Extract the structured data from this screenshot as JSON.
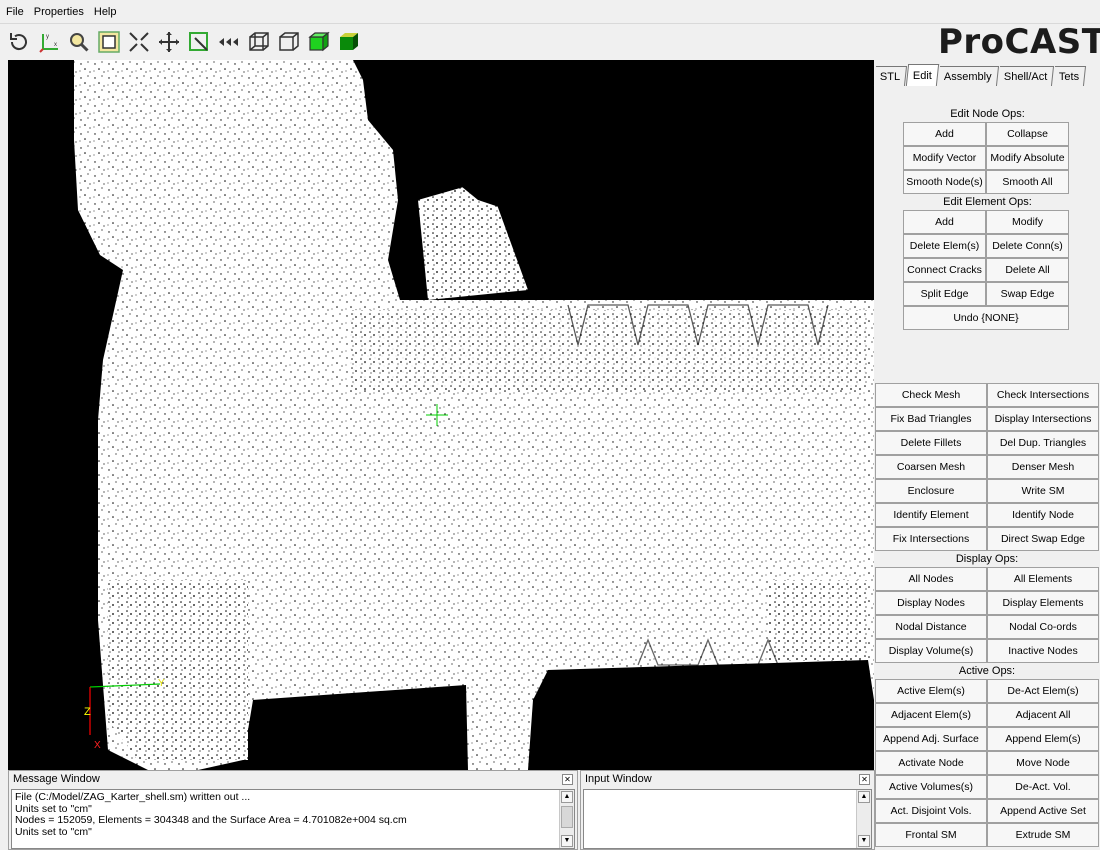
{
  "menu": [
    "File",
    "Properties",
    "Help"
  ],
  "toolbar_icons": [
    "rotate-icon",
    "axes-icon",
    "zoom-icon",
    "frame-icon",
    "shrink-icon",
    "pan-icon",
    "select-icon",
    "arrows-icon",
    "wire-box-icon",
    "outline-box-icon",
    "green-cube-icon",
    "shaded-cube-icon"
  ],
  "brand": "ProCAST",
  "tabs": [
    "STL",
    "Edit",
    "Assembly",
    "Shell/Act",
    "Tets"
  ],
  "active_tab": "Edit",
  "edit_panel": {
    "node_ops_label": "Edit Node Ops:",
    "node_ops": [
      "Add",
      "Collapse",
      "Modify Vector",
      "Modify Absolute",
      "Smooth Node(s)",
      "Smooth All"
    ],
    "element_ops_label": "Edit Element Ops:",
    "element_ops": [
      "Add",
      "Modify",
      "Delete Elem(s)",
      "Delete Conn(s)",
      "Connect Cracks",
      "Delete All",
      "Split Edge",
      "Swap Edge"
    ],
    "undo": "Undo {NONE}"
  },
  "mesh_ops": [
    "Check Mesh",
    "Check Intersections",
    "Fix Bad Triangles",
    "Display Intersections",
    "Delete Fillets",
    "Del Dup. Triangles",
    "Coarsen Mesh",
    "Denser Mesh",
    "Enclosure",
    "Write SM",
    "Identify Element",
    "Identify Node",
    "Fix Intersections",
    "Direct Swap Edge"
  ],
  "display_ops_label": "Display Ops:",
  "display_ops": [
    "All Nodes",
    "All Elements",
    "Display Nodes",
    "Display Elements",
    "Nodal Distance",
    "Nodal Co-ords",
    "Display Volume(s)",
    "Inactive Nodes"
  ],
  "active_ops_label": "Active Ops:",
  "active_ops": [
    "Active Elem(s)",
    "De-Act Elem(s)",
    "Adjacent Elem(s)",
    "Adjacent All",
    "Append Adj. Surface",
    "Append Elem(s)",
    "Activate Node",
    "Move Node",
    "Active Volumes(s)",
    "De-Act. Vol.",
    "Act. Disjoint Vols.",
    "Append Active Set",
    "Frontal SM",
    "Extrude SM"
  ],
  "axes": {
    "x": "X",
    "y": "Y",
    "z": "Z"
  },
  "message_window": {
    "title": "Message Window",
    "lines": [
      "File (C:/Model/ZAG_Karter_shell.sm) written out ...",
      "Units set to \"cm\"",
      "Nodes = 152059,  Elements = 304348 and the Surface Area = 4.701082e+004 sq.cm",
      "Units set to \"cm\""
    ]
  },
  "input_window": {
    "title": "Input Window"
  },
  "colors": {
    "viewport_bg": "#000000",
    "mesh": "#ffffff",
    "cursor": "#00cc00",
    "axis_x": "#ff0000",
    "axis_y": "#00cc00",
    "axis_z": "#ffff00"
  }
}
